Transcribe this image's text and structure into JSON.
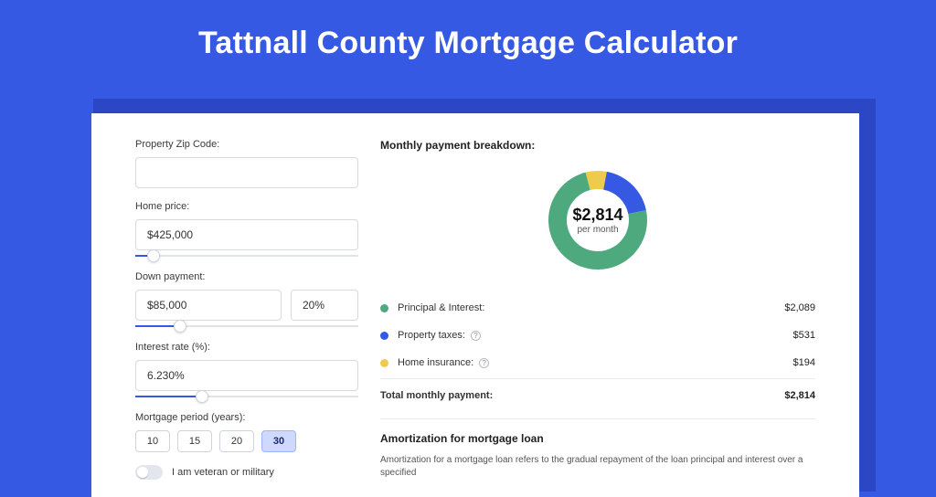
{
  "title": "Tattnall County Mortgage Calculator",
  "form": {
    "zip_label": "Property Zip Code:",
    "zip_value": "",
    "home_price_label": "Home price:",
    "home_price_value": "$425,000",
    "home_price_slider_pct": 8,
    "down_payment_label": "Down payment:",
    "down_payment_value": "$85,000",
    "down_payment_pct_value": "20%",
    "down_payment_slider_pct": 20,
    "interest_label": "Interest rate (%):",
    "interest_value": "6.230%",
    "interest_slider_pct": 30,
    "period_label": "Mortgage period (years):",
    "period_options": [
      "10",
      "15",
      "20",
      "30"
    ],
    "period_selected": "30",
    "veteran_label": "I am veteran or military",
    "veteran_on": false
  },
  "breakdown": {
    "title": "Monthly payment breakdown:",
    "donut_value": "$2,814",
    "donut_sub": "per month",
    "colors": {
      "principal": "#4fa97e",
      "taxes": "#3659e3",
      "insurance": "#eecb4d"
    },
    "items": [
      {
        "key": "principal",
        "label": "Principal & Interest:",
        "amount": "$2,089",
        "color": "#4fa97e",
        "info": false
      },
      {
        "key": "taxes",
        "label": "Property taxes:",
        "amount": "$531",
        "color": "#3659e3",
        "info": true
      },
      {
        "key": "insurance",
        "label": "Home insurance:",
        "amount": "$194",
        "color": "#eecb4d",
        "info": true
      }
    ],
    "total_label": "Total monthly payment:",
    "total_amount": "$2,814"
  },
  "amort": {
    "title": "Amortization for mortgage loan",
    "text": "Amortization for a mortgage loan refers to the gradual repayment of the loan principal and interest over a specified"
  },
  "chart_data": {
    "type": "pie",
    "title": "Monthly payment breakdown",
    "series": [
      {
        "name": "Principal & Interest",
        "value": 2089,
        "color": "#4fa97e"
      },
      {
        "name": "Property taxes",
        "value": 531,
        "color": "#3659e3"
      },
      {
        "name": "Home insurance",
        "value": 194,
        "color": "#eecb4d"
      }
    ],
    "total": 2814,
    "center_label": "$2,814 per month"
  }
}
